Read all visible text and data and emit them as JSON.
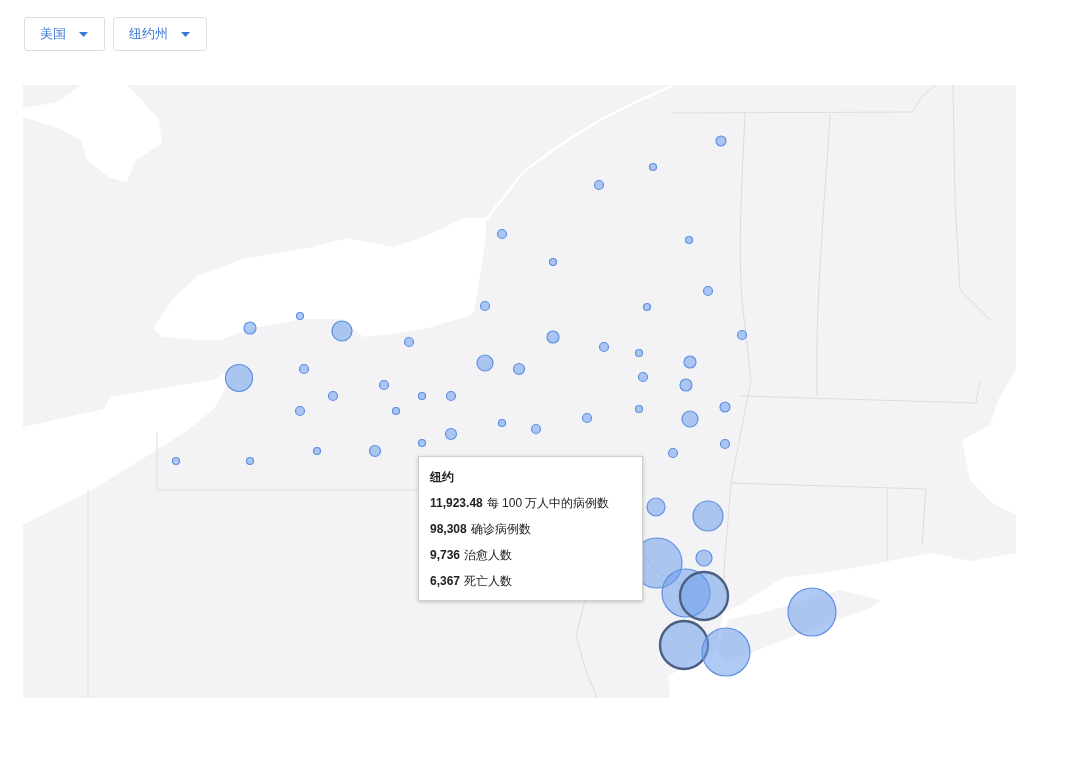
{
  "filters": [
    {
      "value": "美国"
    },
    {
      "value": "纽约州"
    }
  ],
  "map": {
    "markers": [
      {
        "selected": false
      },
      {
        "selected": false
      },
      {
        "selected": false
      },
      {
        "selected": false
      },
      {
        "selected": false
      },
      {
        "selected": false
      },
      {
        "selected": false
      },
      {
        "selected": false
      },
      {
        "selected": false
      },
      {
        "selected": false
      },
      {
        "selected": false
      },
      {
        "selected": false
      },
      {
        "selected": false
      },
      {
        "selected": false
      },
      {
        "selected": false
      },
      {
        "selected": false
      },
      {
        "selected": false
      },
      {
        "selected": false
      },
      {
        "selected": false
      },
      {
        "selected": false
      },
      {
        "selected": false
      },
      {
        "selected": false
      },
      {
        "selected": false
      },
      {
        "selected": false
      },
      {
        "selected": false
      },
      {
        "selected": false
      },
      {
        "selected": false
      },
      {
        "selected": false
      },
      {
        "selected": false
      },
      {
        "selected": false
      },
      {
        "selected": false
      },
      {
        "selected": false
      },
      {
        "selected": false
      },
      {
        "selected": false
      },
      {
        "selected": false
      },
      {
        "selected": false
      },
      {
        "selected": false
      },
      {
        "selected": false
      },
      {
        "selected": false
      },
      {
        "selected": false
      },
      {
        "selected": false
      },
      {
        "selected": false
      },
      {
        "selected": false
      },
      {
        "selected": false
      },
      {
        "selected": false
      },
      {
        "selected": false
      },
      {
        "selected": false
      },
      {
        "selected": false
      },
      {
        "selected": false
      },
      {
        "selected": true
      },
      {
        "selected": true
      },
      {
        "selected": false
      },
      {
        "selected": false
      }
    ],
    "tooltip": {
      "title": "纽约",
      "rows": [
        {
          "value": "11,923.48",
          "label": "每 100 万人中的病例数"
        },
        {
          "value": "98,308",
          "label": "确诊病例数"
        },
        {
          "value": "9,736",
          "label": "治愈人数"
        },
        {
          "value": "6,367",
          "label": "死亡人数"
        }
      ]
    }
  }
}
